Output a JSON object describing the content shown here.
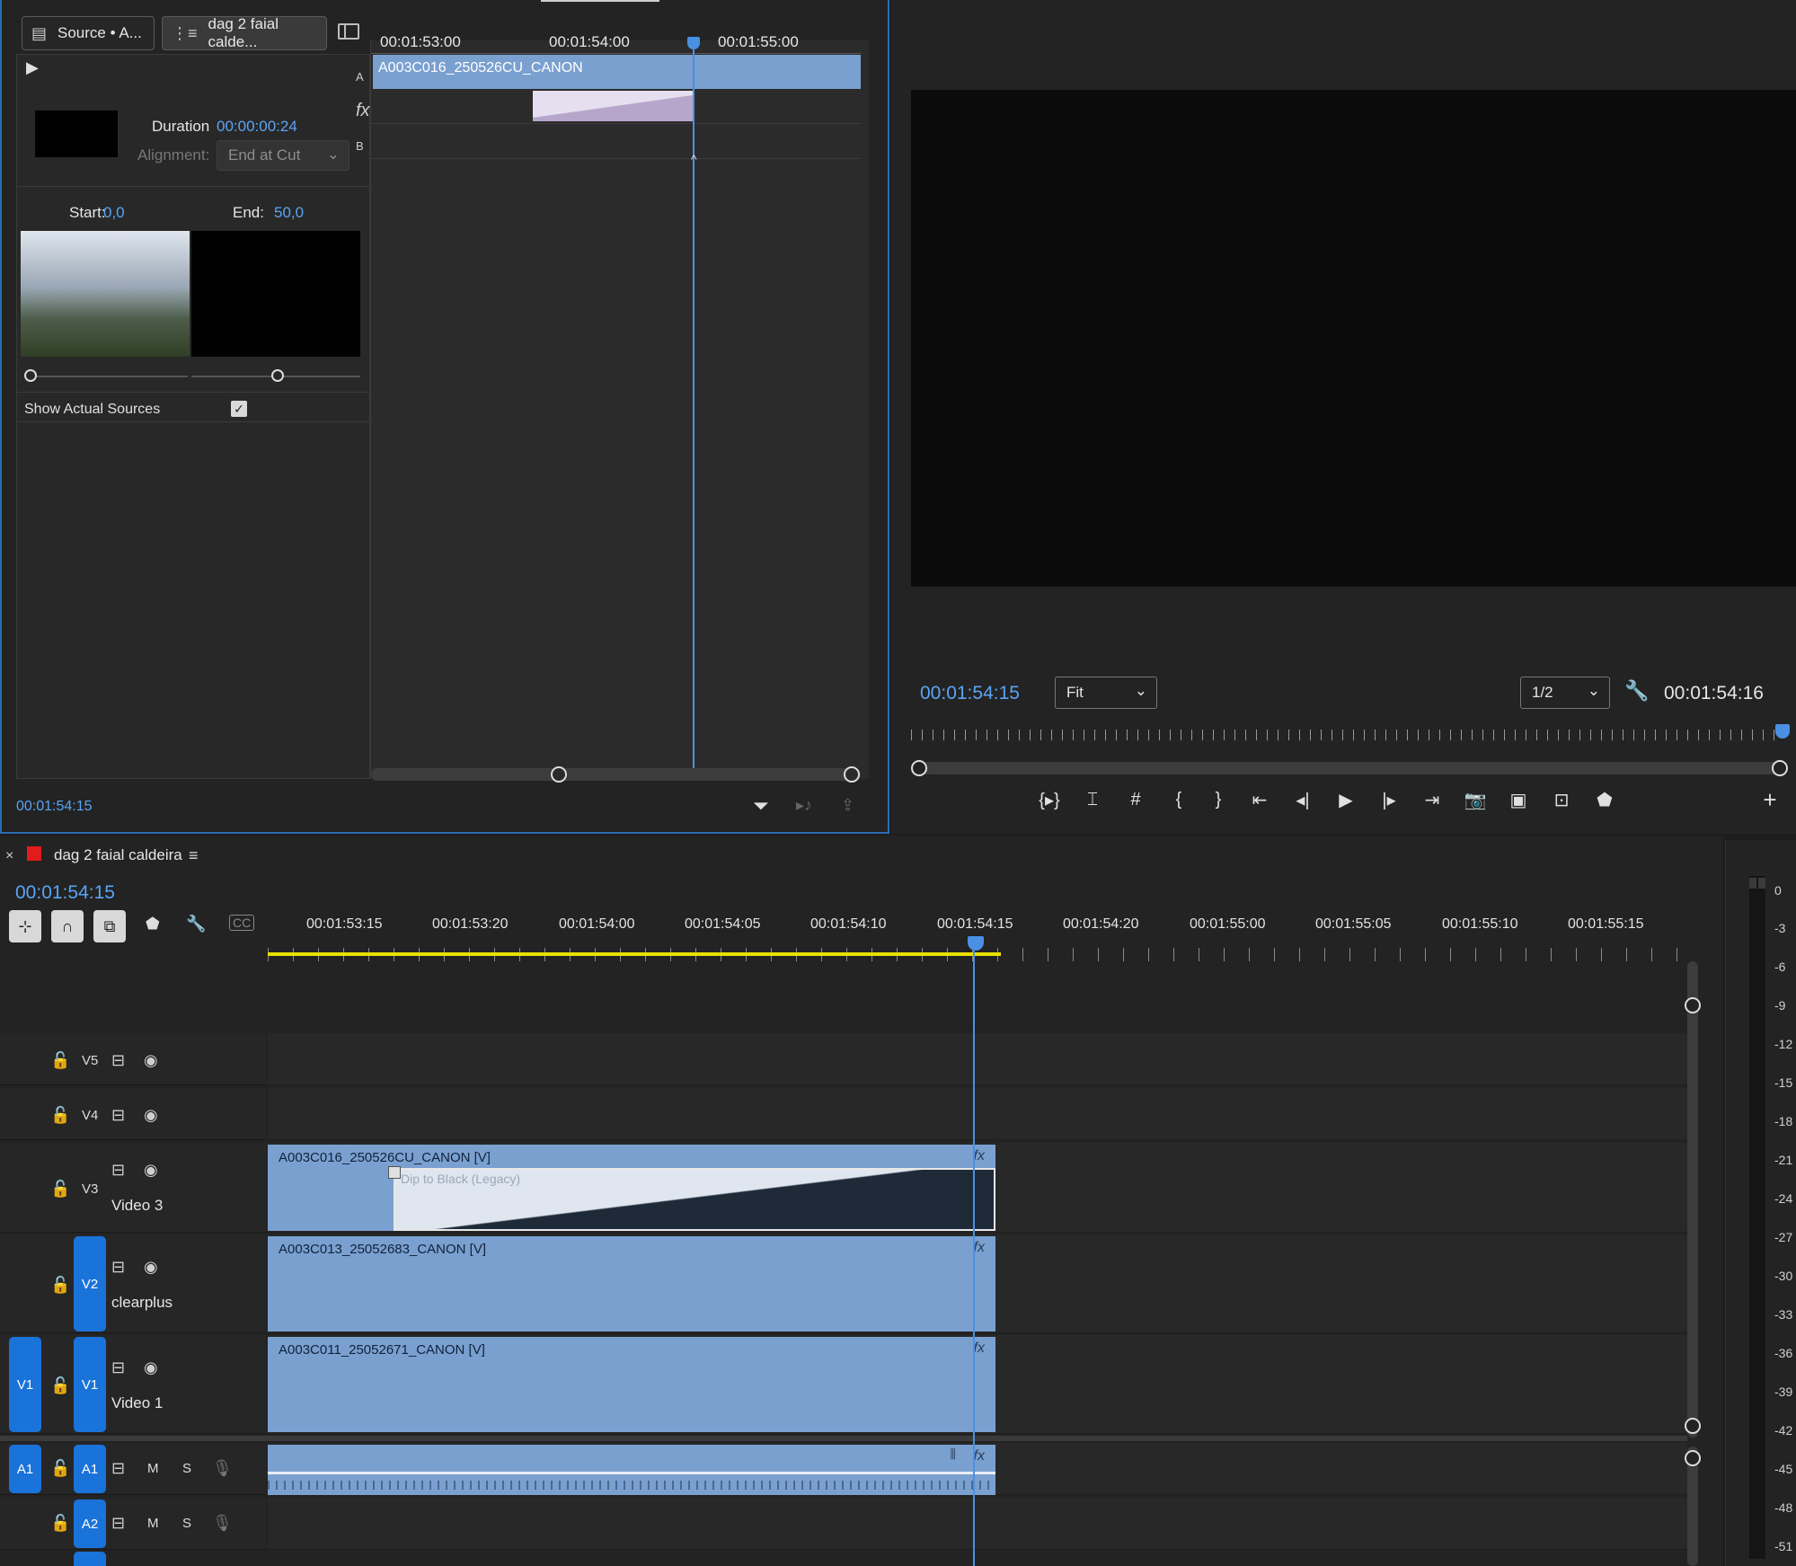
{
  "effect_controls": {
    "tab_source": "Source • A...",
    "tab_sequence": "dag 2 faial calde...",
    "ruler": [
      "00:01:53:00",
      "00:01:54:00",
      "00:01:55:00"
    ],
    "track_a_label": "A",
    "track_b_label": "B",
    "fx_label": "fx",
    "clip_a_name": "A003C016_250526CU_CANON",
    "duration_label": "Duration",
    "duration_value": "00:00:00:24",
    "alignment_label": "Alignment:",
    "alignment_value": "End at Cut",
    "start_label": "Start:",
    "start_value": "0,0",
    "end_label": "End:",
    "end_value": "50,0",
    "show_actual_sources": "Show Actual Sources",
    "show_actual_sources_checked": true,
    "timecode": "00:01:54:15"
  },
  "program_monitor": {
    "timecode_current": "00:01:54:15",
    "zoom_value": "Fit",
    "resolution_value": "1/2",
    "timecode_duration": "00:01:54:16"
  },
  "timeline": {
    "sequence_name": "dag 2 faial caldeira",
    "timecode": "00:01:54:15",
    "ruler": [
      "00:01:53:15",
      "00:01:53:20",
      "00:01:54:00",
      "00:01:54:05",
      "00:01:54:10",
      "00:01:54:15",
      "00:01:54:20",
      "00:01:55:00",
      "00:01:55:05",
      "00:01:55:10",
      "00:01:55:15"
    ],
    "tracks": {
      "v5": "V5",
      "v4": "V4",
      "v3": "V3",
      "v3_name": "Video 3",
      "v2": "V2",
      "v2_name": "clearplus",
      "v1": "V1",
      "v1_src": "V1",
      "v1_name": "Video 1",
      "a1": "A1",
      "a1_src": "A1",
      "a2": "A2",
      "m": "M",
      "s": "S"
    },
    "clips": {
      "v3_clip": "A003C016_250526CU_CANON [V]",
      "transition": "Dip to Black (Legacy)",
      "v2_clip": "A003C013_25052683_CANON [V]",
      "v1_clip": "A003C011_25052671_CANON [V]",
      "fx": "fx"
    }
  },
  "audio_meter": {
    "labels": [
      "0",
      "-3",
      "-6",
      "-9",
      "-12",
      "-15",
      "-18",
      "-21",
      "-24",
      "-27",
      "-30",
      "-33",
      "-36",
      "-39",
      "-42",
      "-45",
      "-48",
      "-51"
    ]
  },
  "colors": {
    "accent": "#5aa4f5",
    "clip": "#7aa0d0",
    "target": "#1a73d9",
    "playhead": "#4a90e2",
    "work_area": "#e8e000"
  }
}
